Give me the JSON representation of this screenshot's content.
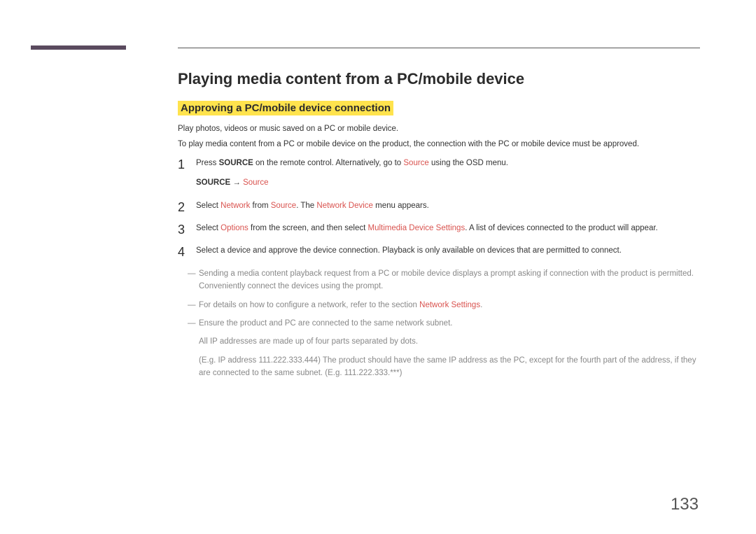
{
  "heading": "Playing media content from a PC/mobile device",
  "subheading": "Approving a PC/mobile device connection",
  "intro1": "Play photos, videos or music saved on a PC or mobile device.",
  "intro2": "To play media content from a PC or mobile device on the product, the connection with the PC or mobile device must be approved.",
  "step1": {
    "a": "Press ",
    "b": "SOURCE",
    "c": " on the remote control. Alternatively, go to ",
    "d": "Source",
    "e": " using the OSD menu.",
    "sub_a": "SOURCE",
    "sub_arrow": " → ",
    "sub_b": "Source"
  },
  "step2": {
    "a": "Select ",
    "b": "Network",
    "c": " from ",
    "d": "Source",
    "e": ". The ",
    "f": "Network Device",
    "g": " menu appears."
  },
  "step3": {
    "a": "Select ",
    "b": "Options",
    "c": " from the screen, and then select ",
    "d": "Multimedia Device Settings",
    "e": ". A list of devices connected to the product will appear."
  },
  "step4": "Select a device and approve the device connection. Playback is only available on devices that are permitted to connect.",
  "note1": "Sending a media content playback request from a PC or mobile device displays a prompt asking if connection with the product is permitted. Conveniently connect the devices using the prompt.",
  "note2": {
    "a": "For details on how to configure a network, refer to the section ",
    "b": "Network Settings",
    "c": "."
  },
  "note3": "Ensure the product and PC are connected to the same network subnet.",
  "note3_sub1": "All IP addresses are made up of four parts separated by dots.",
  "note3_sub2": "(E.g. IP address 111.222.333.444) The product should have the same IP address as the PC, except for the fourth part of the address, if they are connected to the same subnet. (E.g. 111.222.333.***)",
  "page_number": "133"
}
